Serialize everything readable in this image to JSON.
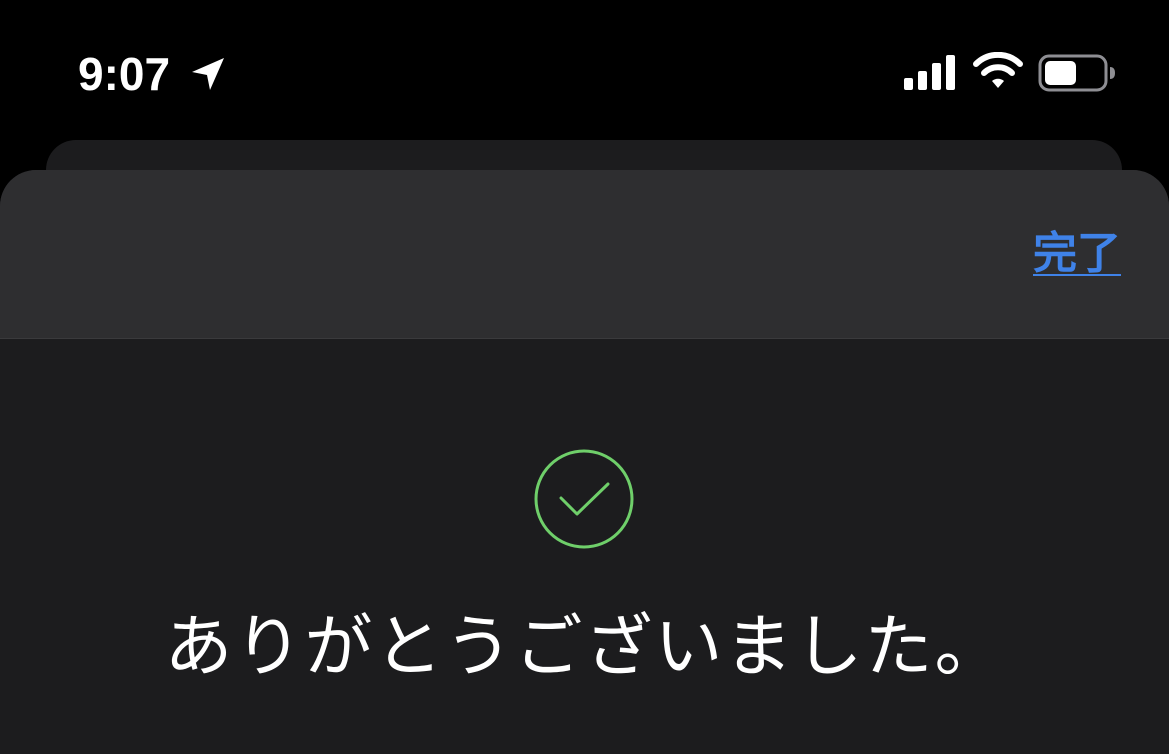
{
  "status_bar": {
    "time": "9:07",
    "location_icon": "location-arrow-icon",
    "signal_icon": "cellular-signal-icon",
    "wifi_icon": "wifi-icon",
    "battery_icon": "battery-icon",
    "battery_level": 0.55
  },
  "sheet": {
    "done_label": "完了",
    "check_icon": "checkmark-circle-icon",
    "message": "ありがとうございました。"
  },
  "colors": {
    "background": "#000000",
    "sheet_body": "#1c1c1e",
    "sheet_header": "#2e2e30",
    "accent_blue": "#3f82e8",
    "success_green": "#6fcf6a",
    "text_primary": "#ffffff"
  }
}
